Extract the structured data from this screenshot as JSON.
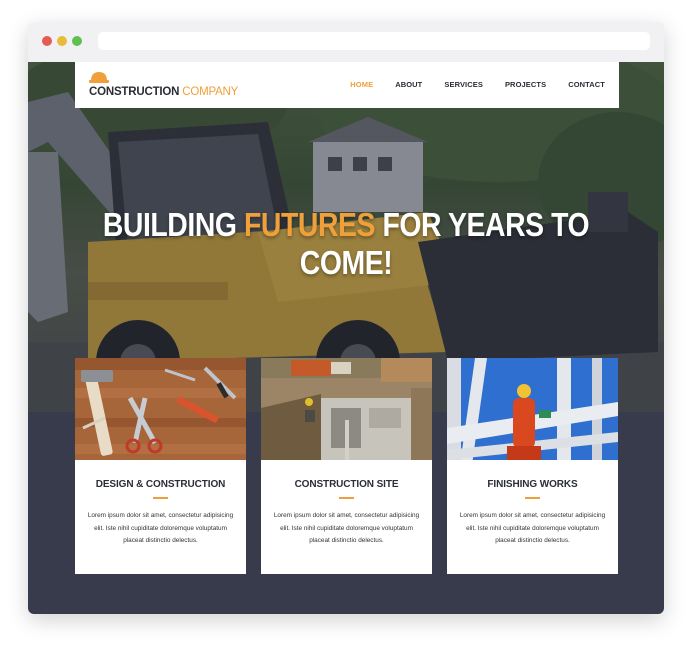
{
  "site": {
    "logo": {
      "icon": "hard-hat-icon",
      "strong": "CONSTRUCTION",
      "light": " COMPANY"
    },
    "nav": [
      {
        "label": "HOME",
        "active": true
      },
      {
        "label": "ABOUT",
        "active": false
      },
      {
        "label": "SERVICES",
        "active": false
      },
      {
        "label": "PROJECTS",
        "active": false
      },
      {
        "label": "CONTACT",
        "active": false
      }
    ]
  },
  "hero": {
    "title_before": "BUILDING ",
    "title_accent": "FUTURES",
    "title_after": " FOR YEARS TO COME!"
  },
  "cards": [
    {
      "title": "DESIGN & CONSTRUCTION",
      "text": "Lorem ipsum dolor sit amet, consectetur adipisicing elit. Iste nihil cupiditate doloremque voluptatum placeat distinctio delectus."
    },
    {
      "title": "CONSTRUCTION SITE",
      "text": "Lorem ipsum dolor sit amet, consectetur adipisicing elit. Iste nihil cupiditate doloremque voluptatum placeat distinctio delectus."
    },
    {
      "title": "FINISHING WORKS",
      "text": "Lorem ipsum dolor sit amet, consectetur adipisicing elit. Iste nihil cupiditate doloremque voluptatum placeat distinctio delectus."
    }
  ],
  "colors": {
    "accent": "#f0a03a",
    "dark": "#373b4b",
    "text": "#2b2e36"
  }
}
